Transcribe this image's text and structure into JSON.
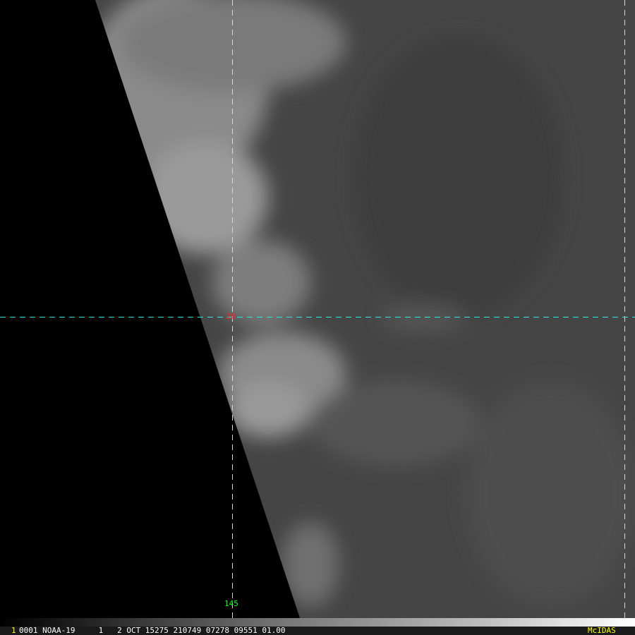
{
  "grid": {
    "lat_label": "20",
    "lon_label": "145",
    "line_color": "#33e6e6"
  },
  "status_bar": {
    "frame_number": "1",
    "info": "0001 NOAA-19     1   2 OCT 15275 210749 07278 09551 01.00",
    "brand": "McIDAS"
  }
}
